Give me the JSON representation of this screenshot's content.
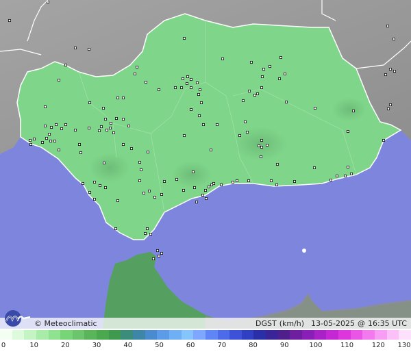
{
  "map": {
    "variable": "DGST",
    "unit": "(km/h)",
    "date": "13-05-2025",
    "time": "16:35 UTC",
    "credit": "© Meteoclimatic",
    "region": "Andalucía",
    "colors": {
      "sea": "#7d86dc",
      "land_outside": "#9a9a9a",
      "region_fill": "#7fd68a",
      "africa": "#55a060"
    }
  },
  "legend": {
    "ticks": [
      "0",
      "10",
      "20",
      "30",
      "40",
      "50",
      "60",
      "70",
      "80",
      "90",
      "100",
      "110",
      "120",
      "130"
    ],
    "colors": [
      "#f4fff4",
      "#ddfadd",
      "#c4f4c4",
      "#a9eca9",
      "#8fe28f",
      "#77d477",
      "#6cc56c",
      "#5ab55a",
      "#4aa84f",
      "#3f9a50",
      "#3a8c7b",
      "#3d86a8",
      "#4a8bd0",
      "#5c9be8",
      "#6fb0f5",
      "#85c5fb",
      "#7ea8ff",
      "#5f86f4",
      "#4d6ae8",
      "#3d52d8",
      "#3140c2",
      "#2a2fa8",
      "#3a2598",
      "#4f1f8c",
      "#6d1fa0",
      "#8a1fb8",
      "#a822c8",
      "#c428d4",
      "#dc36dc",
      "#ea55e6",
      "#f27aee",
      "#f79df4",
      "#fbc0f8",
      "#fde0fb"
    ]
  },
  "stations_note": "station markers"
}
